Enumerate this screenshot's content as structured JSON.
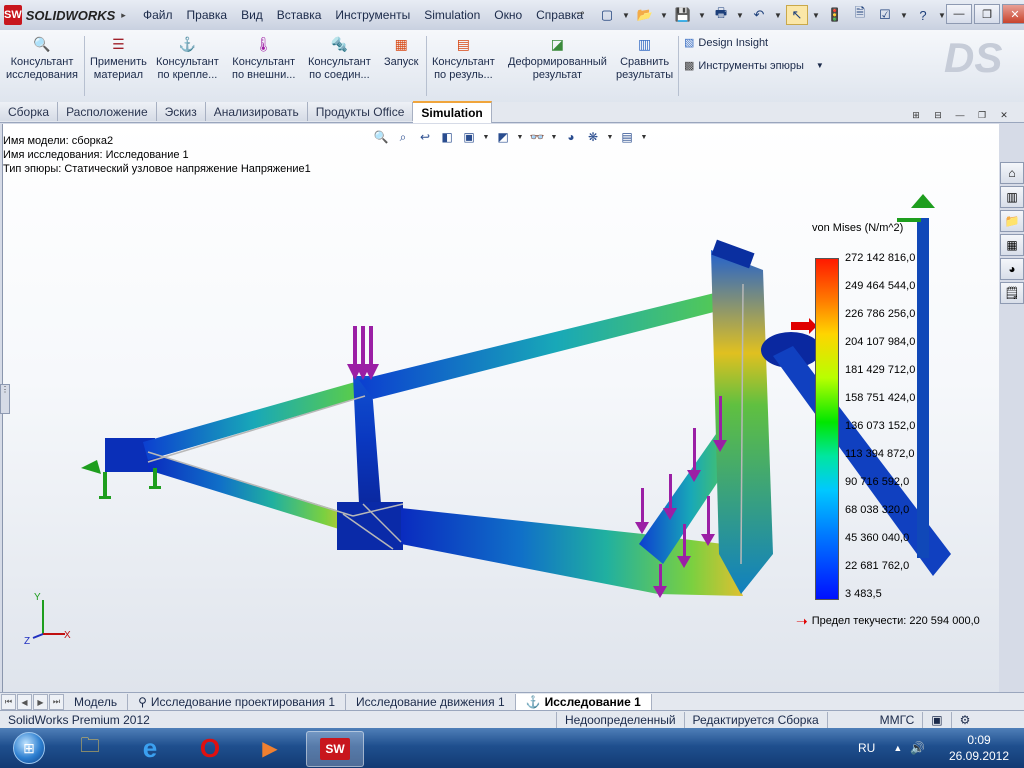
{
  "app": {
    "brand": "SOLIDWORKS",
    "brand_mark": "SW"
  },
  "menu": [
    "Файл",
    "Правка",
    "Вид",
    "Вставка",
    "Инструменты",
    "Simulation",
    "Окно",
    "Справка"
  ],
  "command_manager": {
    "commands": [
      {
        "label1": "Консультант",
        "label2": "исследования",
        "icon": "study-advisor-icon"
      },
      {
        "label1": "Применить",
        "label2": "материал",
        "icon": "apply-material-icon"
      },
      {
        "label1": "Консультант",
        "label2": "по крепле...",
        "icon": "fixtures-advisor-icon"
      },
      {
        "label1": "Консультант",
        "label2": "по внешни...",
        "icon": "external-loads-advisor-icon"
      },
      {
        "label1": "Консультант",
        "label2": "по соедин...",
        "icon": "connections-advisor-icon"
      },
      {
        "label1": "Запуск",
        "label2": "",
        "icon": "run-icon"
      },
      {
        "label1": "Консультант",
        "label2": "по резуль...",
        "icon": "results-advisor-icon"
      },
      {
        "label1": "Деформированный",
        "label2": "результат",
        "icon": "deformed-result-icon"
      },
      {
        "label1": "Сравнить",
        "label2": "результаты",
        "icon": "compare-results-icon"
      }
    ],
    "design_insight": "Design Insight",
    "plot_tools": "Инструменты эпюры"
  },
  "tabs": [
    "Сборка",
    "Расположение",
    "Эскиз",
    "Анализировать",
    "Продукты Office",
    "Simulation"
  ],
  "active_tab": "Simulation",
  "info": {
    "model": "Имя модели: сборка2",
    "study": "Имя  исследования: Исследование 1",
    "plot_type": "Тип эпюры: Статический узловое напряжение Напряжение1"
  },
  "legend": {
    "title": "von Mises (N/m^2)",
    "values": [
      "272 142 816,0",
      "249 464 544,0",
      "226 786 256,0",
      "204 107 984,0",
      "181 429 712,0",
      "158 751 424,0",
      "136 073 152,0",
      "113 394 872,0",
      "90 716 592,0",
      "68 038 320,0",
      "45 360 040,0",
      "22 681 762,0",
      "3 483,5"
    ],
    "yield": "Предел текучести: 220 594 000,0",
    "yield_color": "#e00000"
  },
  "axes": {
    "y": "Y",
    "x": "X",
    "z": "Z"
  },
  "bottom_tabs": [
    "Модель",
    "Исследование проектирования 1",
    "Исследование движения 1",
    "Исследование 1"
  ],
  "active_bottom_tab": "Исследование 1",
  "status": {
    "product": "SolidWorks Premium 2012",
    "definition": "Недоопределенный",
    "mode": "Редактируется Сборка",
    "units": "ММГС"
  },
  "taskbar": {
    "lang": "RU",
    "time": "0:09",
    "date": "26.09.2012"
  },
  "colors": {
    "accent": "#f0a53c",
    "load_arrow": "#9b1fa5",
    "fixture": "#1e9e1e"
  }
}
